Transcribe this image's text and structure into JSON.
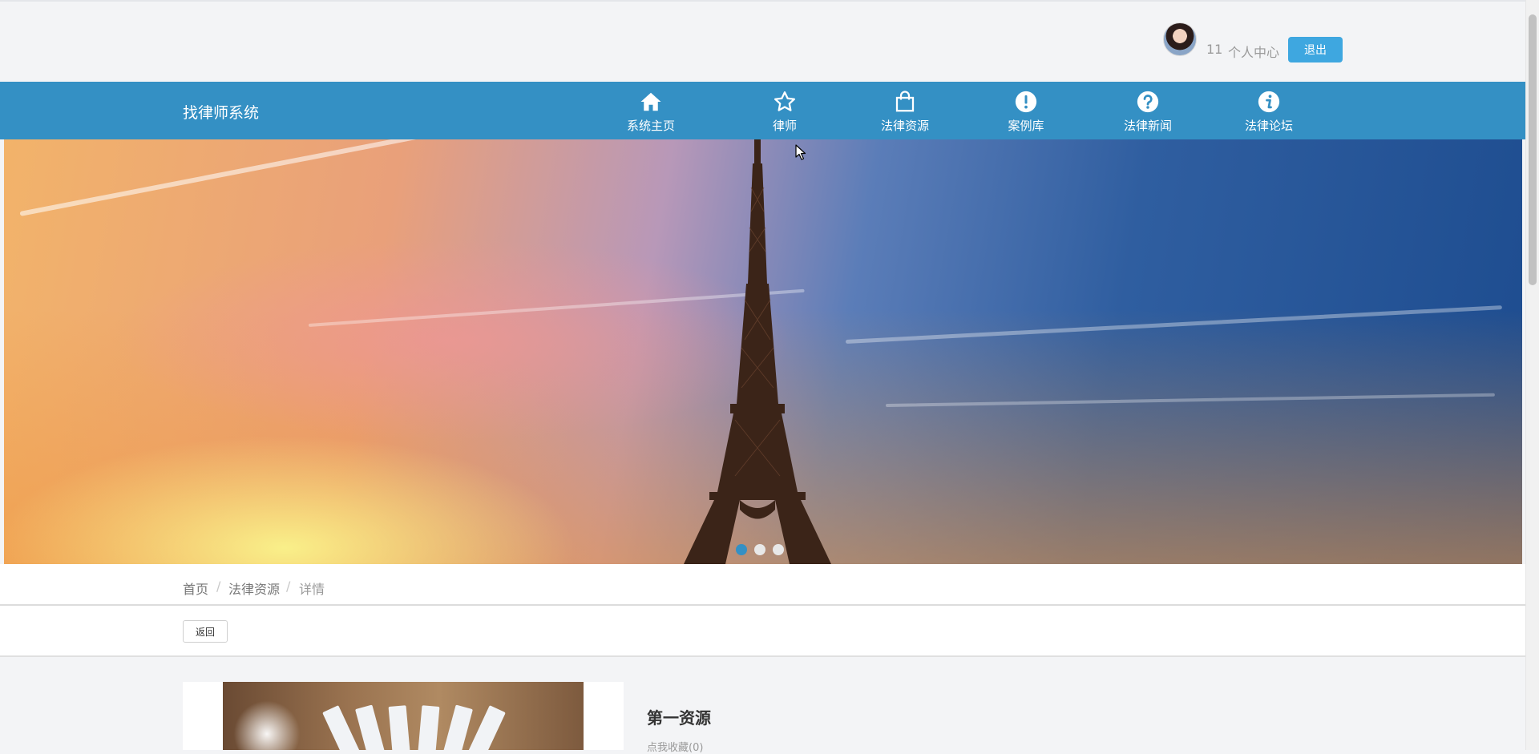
{
  "header": {
    "user_name": "11",
    "personal_center": "个人中心",
    "logout": "退出"
  },
  "nav": {
    "brand": "找律师系统",
    "items": [
      {
        "label": "系统主页",
        "icon": "home-icon"
      },
      {
        "label": "律师",
        "icon": "star-icon"
      },
      {
        "label": "法律资源",
        "icon": "shopping-bag-icon"
      },
      {
        "label": "案例库",
        "icon": "exclamation-circle-icon"
      },
      {
        "label": "法律新闻",
        "icon": "question-circle-icon"
      },
      {
        "label": "法律论坛",
        "icon": "info-circle-icon"
      }
    ]
  },
  "carousel": {
    "active_index": 0,
    "slide_count": 3
  },
  "breadcrumb": {
    "items": [
      "首页",
      "法律资源",
      "详情"
    ],
    "separator": "/"
  },
  "actions": {
    "back": "返回"
  },
  "detail": {
    "title": "第一资源",
    "favorite": "点我收藏(0)"
  },
  "colors": {
    "nav_bg": "#3490c4",
    "accent": "#3ea7e0",
    "dot_active": "#3490c4",
    "dot_inactive": "#e8e8e8"
  }
}
